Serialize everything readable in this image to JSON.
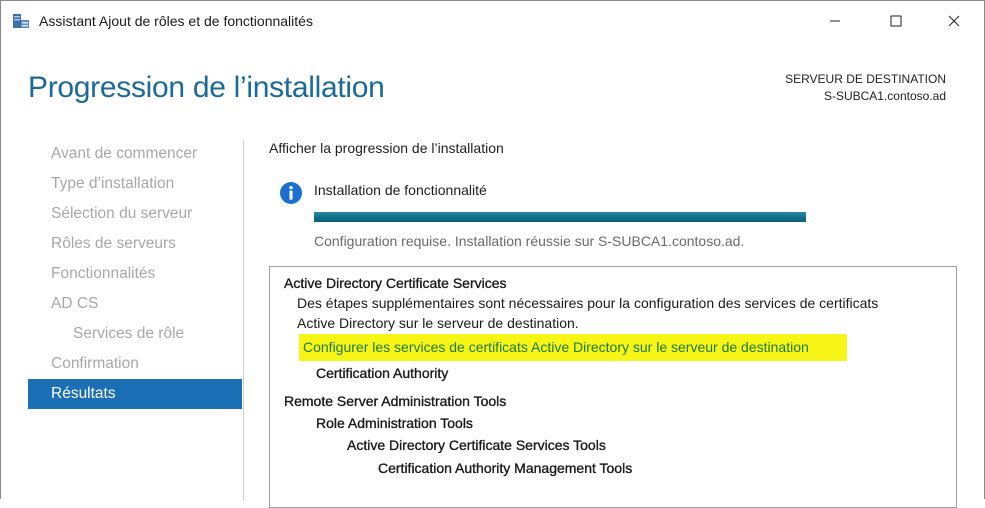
{
  "window": {
    "title": "Assistant Ajout de rôles et de fonctionnalités",
    "app_icon": "server-manager-icon",
    "controls": [
      "minimize-icon",
      "maximize-icon",
      "close-icon"
    ]
  },
  "header": {
    "page_title": "Progression de l’installation",
    "destination_label": "SERVEUR DE DESTINATION",
    "destination_server": "S-SUBCA1.contoso.ad"
  },
  "sidebar": {
    "items": [
      {
        "label": "Avant de commencer",
        "state": "disabled"
      },
      {
        "label": "Type d’installation",
        "state": "disabled"
      },
      {
        "label": "Sélection du serveur",
        "state": "disabled"
      },
      {
        "label": "Rôles de serveurs",
        "state": "disabled"
      },
      {
        "label": "Fonctionnalités",
        "state": "disabled"
      },
      {
        "label": "AD CS",
        "state": "disabled"
      },
      {
        "label": "Services de rôle",
        "state": "disabled"
      },
      {
        "label": "Confirmation",
        "state": "disabled"
      },
      {
        "label": "Résultats",
        "state": "active"
      }
    ]
  },
  "main": {
    "heading": "Afficher la progression de l’installation",
    "install_label": "Installation de fonctionnalité",
    "progress_fraction": 1.0,
    "status_text": "Configuration requise. Installation réussie sur S-SUBCA1.contoso.ad.",
    "results": {
      "adcs_title": "Active Directory Certificate Services",
      "adcs_desc_line1": "Des étapes supplémentaires sont nécessaires pour la configuration des services de certificats",
      "adcs_desc_line2": "Active Directory sur le serveur de destination.",
      "config_link": "Configurer les services de certificats Active Directory sur le serveur de destination",
      "ca_item": "Certification Authority",
      "rsat_title": "Remote Server Administration Tools",
      "rat_item": "Role Administration Tools",
      "adcs_tools_item": "Active Directory Certificate Services Tools",
      "ca_mgmt_item": "Certification Authority Management Tools"
    }
  },
  "colors": {
    "title_blue": "#1c6a96",
    "active_nav": "#1a6fb5",
    "progress": "#0e6d86",
    "link_highlight": "#f6f516",
    "link_text": "#1f7a2e"
  }
}
